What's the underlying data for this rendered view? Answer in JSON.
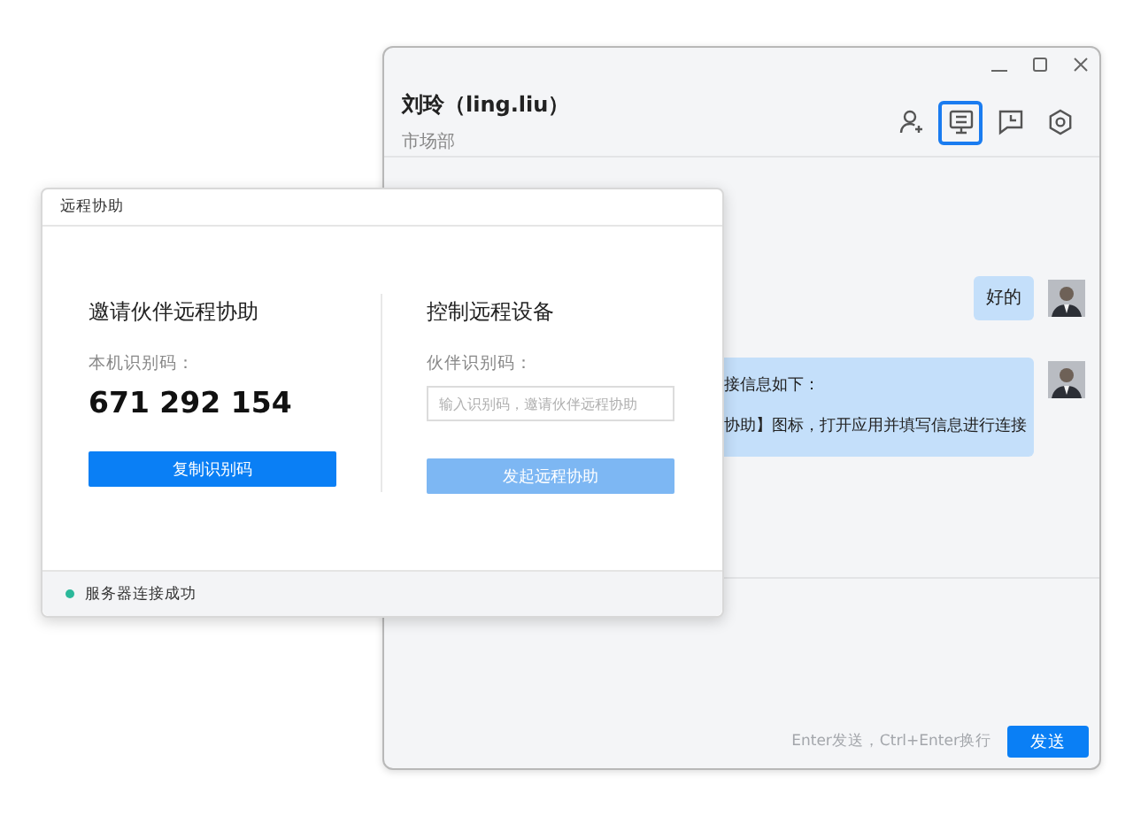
{
  "chat_window": {
    "contact_name": "刘玲（ling.liu）",
    "department": "市场部",
    "toolbar": [
      {
        "kind": "add-member",
        "selected": false
      },
      {
        "kind": "remote-assist",
        "selected": true
      },
      {
        "kind": "history",
        "selected": false
      },
      {
        "kind": "settings",
        "selected": false
      }
    ],
    "messages": [
      {
        "lines": [
          "好的"
        ]
      },
      {
        "lines": [
          "接信息如下：",
          "协助】图标，打开应用并填写信息进行连接"
        ]
      }
    ],
    "input_hint": "Enter发送，Ctrl+Enter换行",
    "send_button": "发送"
  },
  "remote_dialog": {
    "title": "远程协助",
    "invite": {
      "heading": "邀请伙伴远程协助",
      "label": "本机识别码：",
      "code": "671 292 154",
      "button": "复制识别码"
    },
    "control": {
      "heading": "控制远程设备",
      "label": "伙伴识别码：",
      "placeholder": "输入识别码，邀请伙伴远程协助",
      "button": "发起远程协助",
      "button_disabled": true
    },
    "status": {
      "text": "服务器连接成功",
      "color": "#2bb89a"
    }
  }
}
